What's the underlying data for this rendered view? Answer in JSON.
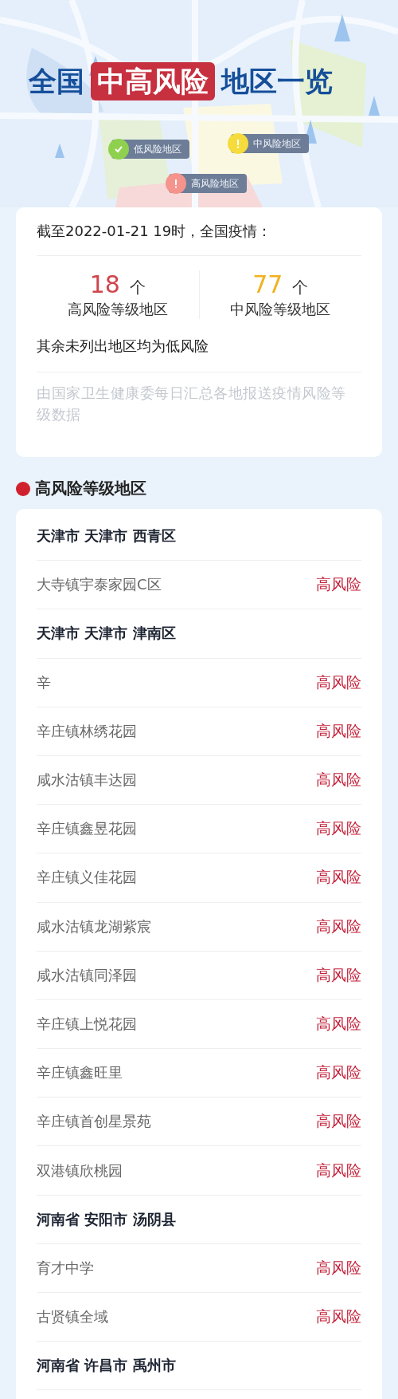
{
  "header": {
    "title_parts": [
      {
        "text": "全国",
        "kind": "plain"
      },
      {
        "text": "中高风险",
        "kind": "highlight"
      },
      {
        "text": "地区一览",
        "kind": "plain"
      }
    ],
    "legend": [
      {
        "label": "低风险地区",
        "kind": "check",
        "color": "#8fd14f"
      },
      {
        "label": "中风险地区",
        "kind": "alert",
        "color": "#f5dc3c"
      },
      {
        "label": "高风险地区",
        "kind": "alert",
        "color": "#f4948c"
      }
    ]
  },
  "summary": {
    "date_line": "截至2022-01-21 19时，全国疫情：",
    "stats": [
      {
        "count": "18",
        "unit": "个",
        "label": "高风险等级地区",
        "color": "#d0454c"
      },
      {
        "count": "77",
        "unit": "个",
        "label": "中风险等级地区",
        "color": "#f0b21e"
      }
    ],
    "note": "其余未列出地区均为低风险",
    "source": "由国家卫生健康委每日汇总各地报送疫情风险等级数据"
  },
  "section": {
    "title": "高风险等级地区",
    "color": "#d0202e"
  },
  "rows": [
    {
      "kind": "group",
      "name": "天津市 天津市 西青区"
    },
    {
      "kind": "item",
      "name": "大寺镇宇泰家园C区",
      "risk": "高风险"
    },
    {
      "kind": "group",
      "name": "天津市 天津市 津南区"
    },
    {
      "kind": "item",
      "name": "辛",
      "risk": "高风险"
    },
    {
      "kind": "item",
      "name": "辛庄镇林绣花园",
      "risk": "高风险"
    },
    {
      "kind": "item",
      "name": "咸水沽镇丰达园",
      "risk": "高风险"
    },
    {
      "kind": "item",
      "name": "辛庄镇鑫昱花园",
      "risk": "高风险"
    },
    {
      "kind": "item",
      "name": "辛庄镇义佳花园",
      "risk": "高风险"
    },
    {
      "kind": "item",
      "name": "咸水沽镇龙湖紫宸",
      "risk": "高风险"
    },
    {
      "kind": "item",
      "name": "咸水沽镇同泽园",
      "risk": "高风险"
    },
    {
      "kind": "item",
      "name": "辛庄镇上悦花园",
      "risk": "高风险"
    },
    {
      "kind": "item",
      "name": "辛庄镇鑫旺里",
      "risk": "高风险"
    },
    {
      "kind": "item",
      "name": "辛庄镇首创星景苑",
      "risk": "高风险"
    },
    {
      "kind": "item",
      "name": "双港镇欣桃园",
      "risk": "高风险"
    },
    {
      "kind": "group",
      "name": "河南省 安阳市 汤阴县"
    },
    {
      "kind": "item",
      "name": "育才中学",
      "risk": "高风险"
    },
    {
      "kind": "item",
      "name": "古贤镇全域",
      "risk": "高风险"
    },
    {
      "kind": "group",
      "name": "河南省 许昌市 禹州市"
    }
  ]
}
